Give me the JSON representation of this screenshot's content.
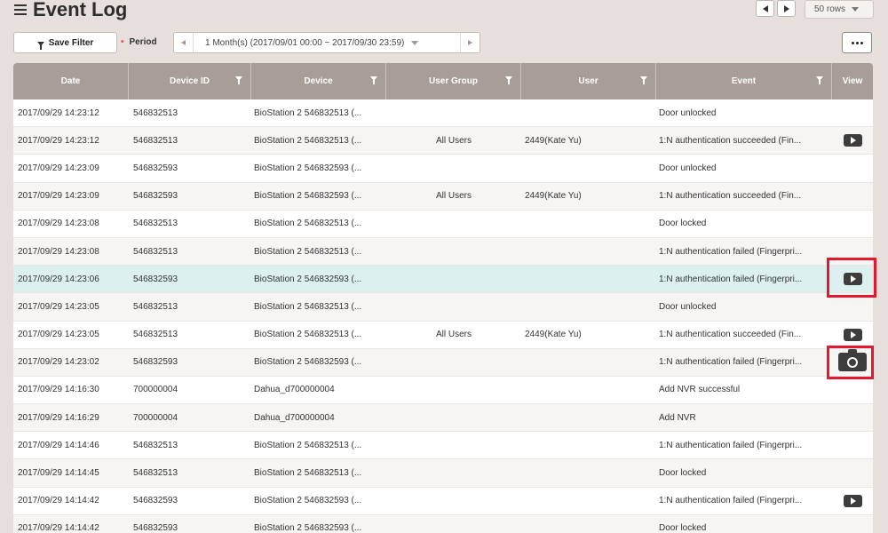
{
  "header": {
    "title": "Event Log",
    "rows_per_page": "50 rows"
  },
  "filter": {
    "save_label": "Save Filter",
    "period_label": "Period",
    "period_value": "1 Month(s) (2017/09/01 00:00 ~ 2017/09/30 23:59)"
  },
  "table": {
    "columns": [
      "Date",
      "Device ID",
      "Device",
      "User Group",
      "User",
      "Event",
      "View"
    ],
    "rows": [
      {
        "date": "2017/09/29 14:23:12",
        "device_id": "546832513",
        "device": "BioStation 2 546832513 (...",
        "group": "",
        "user": "",
        "event": "Door unlocked",
        "view": ""
      },
      {
        "date": "2017/09/29 14:23:12",
        "device_id": "546832513",
        "device": "BioStation 2 546832513 (...",
        "group": "All Users",
        "user": "2449(Kate Yu)",
        "event": "1:N authentication succeeded (Fin...",
        "view": "video-icon"
      },
      {
        "date": "2017/09/29 14:23:09",
        "device_id": "546832593",
        "device": "BioStation 2 546832593 (...",
        "group": "",
        "user": "",
        "event": "Door unlocked",
        "view": ""
      },
      {
        "date": "2017/09/29 14:23:09",
        "device_id": "546832593",
        "device": "BioStation 2 546832593 (...",
        "group": "All Users",
        "user": "2449(Kate Yu)",
        "event": "1:N authentication succeeded (Fin...",
        "view": ""
      },
      {
        "date": "2017/09/29 14:23:08",
        "device_id": "546832513",
        "device": "BioStation 2 546832513 (...",
        "group": "",
        "user": "",
        "event": "Door locked",
        "view": ""
      },
      {
        "date": "2017/09/29 14:23:08",
        "device_id": "546832513",
        "device": "BioStation 2 546832513 (...",
        "group": "",
        "user": "",
        "event": "1:N authentication failed (Fingerpri...",
        "view": ""
      },
      {
        "date": "2017/09/29 14:23:06",
        "device_id": "546832593",
        "device": "BioStation 2 546832593 (...",
        "group": "",
        "user": "",
        "event": "1:N authentication failed (Fingerpri...",
        "view": "video-icon"
      },
      {
        "date": "2017/09/29 14:23:05",
        "device_id": "546832513",
        "device": "BioStation 2 546832513 (...",
        "group": "",
        "user": "",
        "event": "Door unlocked",
        "view": ""
      },
      {
        "date": "2017/09/29 14:23:05",
        "device_id": "546832513",
        "device": "BioStation 2 546832513 (...",
        "group": "All Users",
        "user": "2449(Kate Yu)",
        "event": "1:N authentication succeeded (Fin...",
        "view": "video-icon"
      },
      {
        "date": "2017/09/29 14:23:02",
        "device_id": "546832593",
        "device": "BioStation 2 546832593 (...",
        "group": "",
        "user": "",
        "event": "1:N authentication failed (Fingerpri...",
        "view": "camera-icon"
      },
      {
        "date": "2017/09/29 14:16:30",
        "device_id": "700000004",
        "device": "Dahua_d700000004",
        "group": "",
        "user": "",
        "event": "Add NVR successful",
        "view": ""
      },
      {
        "date": "2017/09/29 14:16:29",
        "device_id": "700000004",
        "device": "Dahua_d700000004",
        "group": "",
        "user": "",
        "event": "Add NVR",
        "view": ""
      },
      {
        "date": "2017/09/29 14:14:46",
        "device_id": "546832513",
        "device": "BioStation 2 546832513 (...",
        "group": "",
        "user": "",
        "event": "1:N authentication failed (Fingerpri...",
        "view": ""
      },
      {
        "date": "2017/09/29 14:14:45",
        "device_id": "546832513",
        "device": "BioStation 2 546832513 (...",
        "group": "",
        "user": "",
        "event": "Door locked",
        "view": ""
      },
      {
        "date": "2017/09/29 14:14:42",
        "device_id": "546832593",
        "device": "BioStation 2 546832593 (...",
        "group": "",
        "user": "",
        "event": "1:N authentication failed (Fingerpri...",
        "view": "video-icon"
      },
      {
        "date": "2017/09/29 14:14:42",
        "device_id": "546832593",
        "device": "BioStation 2 546832593 (...",
        "group": "",
        "user": "",
        "event": "Door locked",
        "view": ""
      }
    ]
  },
  "colors": {
    "header_bg": "#a89e99",
    "page_bg": "#e6dfdb",
    "selected_row": "#dcf0f0",
    "highlight": "#e2182c"
  }
}
